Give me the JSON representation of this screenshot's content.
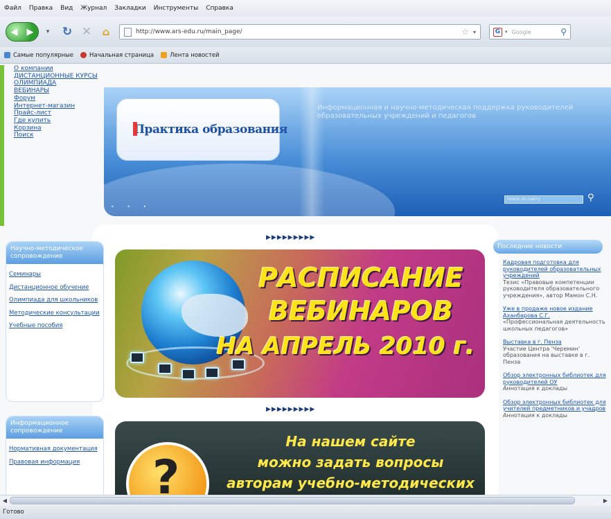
{
  "browser": {
    "menu": [
      "Файл",
      "Правка",
      "Вид",
      "Журнал",
      "Закладки",
      "Инструменты",
      "Справка"
    ],
    "url": "http://www.ars-edu.ru/main_page/",
    "search_placeholder": "Google",
    "bookmarks": [
      "Самые популярные",
      "Начальная страница",
      "Лента новостей"
    ],
    "status": "Готово"
  },
  "site": {
    "top_nav": [
      "О компании",
      "ДИСТАНЦИОННЫЕ КУРСЫ",
      "ОЛИМПИАДА",
      "ВЕБИНАРЫ",
      "Форум",
      "Интернет-магазин",
      "Прайс-лист",
      "Где купить",
      "Корзина",
      "Поиск"
    ],
    "logo": "Практика образования",
    "tagline": "Информационная и научно-методическая поддержка руководителей образовательных учреждений и педагогов",
    "search_placeholder": "поиск по сайту",
    "left_box1": {
      "title": "Научно-методическое сопровождение",
      "links": [
        "Семинары",
        "Дистанционное обучение",
        "Олимпиада для школьников",
        "Методические консультации",
        "Учебные пособия"
      ]
    },
    "left_box2": {
      "title": "Информационное сопровождение",
      "links": [
        "Нормативная документация",
        "Правовая информация"
      ]
    },
    "arrows": "▶▶▶▶▶▶▶▶▶",
    "banner1": {
      "line1": "РАСПИСАНИЕ",
      "line2": "ВЕБИНАРОВ",
      "line3": "НА АПРЕЛЬ 2010 г."
    },
    "banner2": {
      "line1": "На нашем сайте",
      "line2": "можно задать вопросы",
      "line3": "авторам учебно-методических"
    },
    "news": {
      "title": "Последние новости",
      "items": [
        {
          "link": "Кадровая подготовка для руководителей образовательных учреждений",
          "text": "Тезис «Правовые компетенции руководителя образовательного учреждения», автор Мамон С.Н."
        },
        {
          "link": "Уже в продаже новое издание Аханбарова С.Г.",
          "text": "«Профессиональная деятельность школьных педагогов»"
        },
        {
          "link": "Выставка в г. Пенза",
          "text": "Участие Центра 'Черемин' образования на выставке в г. Пенза"
        },
        {
          "link": "Обзор электронных библиотек для руководителей ОУ",
          "text": "Аннотация к доклады"
        },
        {
          "link": "Обзор электронных библиотек для учителей предметников и учадров",
          "text": "Аннотация к доклады"
        }
      ]
    }
  },
  "colors": {
    "accent_green": "#78c13c",
    "header_blue": "#1d5fb6",
    "link_blue": "#1c55b3",
    "banner_yellow": "#ffe31a"
  }
}
